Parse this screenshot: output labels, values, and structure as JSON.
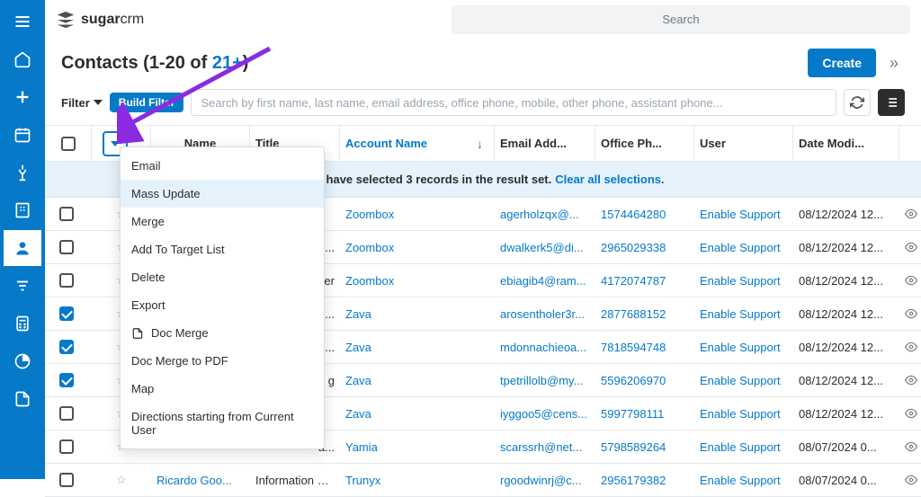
{
  "app": {
    "logo_bold": "sugar",
    "logo_light": "crm",
    "search_placeholder": "Search"
  },
  "page": {
    "title_prefix": "Contacts",
    "count_text": "1-20 of ",
    "count_highlight": "21+",
    "create_label": "Create"
  },
  "filter": {
    "label": "Filter",
    "build_label": "Build Filter",
    "placeholder": "Search by first name, last name, email address, office phone, mobile, other phone, assistant phone..."
  },
  "columns": {
    "name": "Name",
    "title": "Title",
    "account": "Account Name",
    "email": "Email Add...",
    "phone": "Office Ph...",
    "user": "User",
    "date": "Date Modi..."
  },
  "banner": {
    "text": "You have selected 3 records in the result set.",
    "link": "Clear all selections."
  },
  "dropdown": {
    "items": [
      "Email",
      "Mass Update",
      "Merge",
      "Add To Target List",
      "Delete",
      "Export",
      "Doc Merge",
      "Doc Merge to PDF",
      "Map",
      "Directions starting from Current User"
    ],
    "highlight_index": 1,
    "doc_icon_indices": [
      6
    ]
  },
  "rows": [
    {
      "checked": false,
      "name": "",
      "title": "",
      "account": "Zoombox",
      "email": "agerholzqx@...",
      "phone": "1574464280",
      "user": "Enable Support",
      "date": "08/12/2024 12..."
    },
    {
      "checked": false,
      "name": "",
      "title": "u...",
      "account": "Zoombox",
      "email": "dwalkerk5@di...",
      "phone": "2965029338",
      "user": "Enable Support",
      "date": "08/12/2024 12..."
    },
    {
      "checked": false,
      "name": "",
      "title": "ger",
      "account": "Zoombox",
      "email": "ebiagib4@ram...",
      "phone": "4172074787",
      "user": "Enable Support",
      "date": "08/12/2024 12..."
    },
    {
      "checked": true,
      "name": "",
      "title": "i...",
      "account": "Zava",
      "email": "arosentholer3r...",
      "phone": "2877688152",
      "user": "Enable Support",
      "date": "08/12/2024 12..."
    },
    {
      "checked": true,
      "name": "",
      "title": "al...",
      "account": "Zava",
      "email": "mdonnachieoa...",
      "phone": "7818594748",
      "user": "Enable Support",
      "date": "08/12/2024 12..."
    },
    {
      "checked": true,
      "name": "",
      "title": "g",
      "account": "Zava",
      "email": "tpetrillolb@my...",
      "phone": "5596206970",
      "user": "Enable Support",
      "date": "08/12/2024 12..."
    },
    {
      "checked": false,
      "name": "",
      "title": "",
      "account": "Zava",
      "email": "iyggoo5@cens...",
      "phone": "5997798111",
      "user": "Enable Support",
      "date": "08/12/2024 12..."
    },
    {
      "checked": false,
      "name": "",
      "title": "a...",
      "account": "Yamia",
      "email": "scarssrh@net...",
      "phone": "5798589264",
      "user": "Enable Support",
      "date": "08/07/2024 0..."
    },
    {
      "checked": false,
      "name": "Ricardo Goo...",
      "title": "Information Sy...",
      "account": "Trunyx",
      "email": "rgoodwinrj@c...",
      "phone": "2956179382",
      "user": "Enable Support",
      "date": "08/07/2024 0..."
    }
  ],
  "colors": {
    "primary": "#0679c8",
    "arrow": "#8a2be2"
  }
}
